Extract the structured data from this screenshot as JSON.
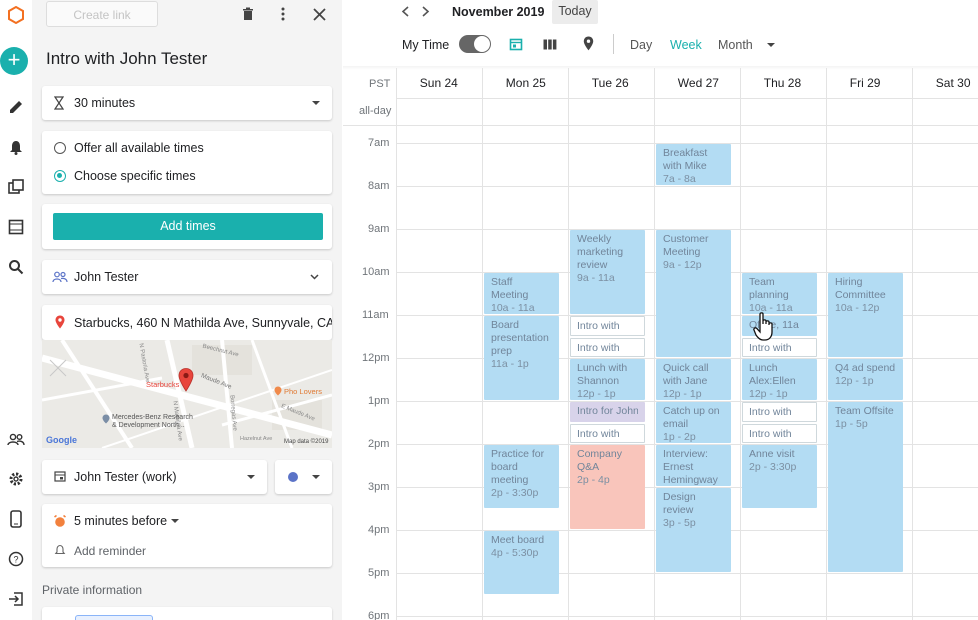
{
  "rail": {
    "add_label": "+"
  },
  "panel": {
    "create_link_label": "Create link",
    "title": "Intro with John Tester",
    "duration": "30 minutes",
    "availability_options": [
      "Offer all available times",
      "Choose specific times"
    ],
    "add_times_label": "Add times",
    "guest": "John Tester",
    "location": "Starbucks, 460 N Mathilda Ave, Sunnyvale, CA 94",
    "map": {
      "place_label": "Starbucks",
      "poi1": "Pho Lovers",
      "poi2": "Mercedes-Benz Research & Development North...",
      "streets": [
        "Beechnut Ave",
        "N Pastoria Ave",
        "Maude Ave",
        "E Maude Ave",
        "N Mathilda Ave",
        "Borregas Ave",
        "Hazelnut Ave"
      ],
      "provider": "Google",
      "attribution": "Map data ©2019"
    },
    "calendar_name": "John Tester (work)",
    "calendar_color": "#5b73c7",
    "reminder": "5 minutes before",
    "add_reminder_label": "Add reminder",
    "private_label": "Private information"
  },
  "calendar": {
    "month": "November 2019",
    "today_label": "Today",
    "my_time_label": "My Time",
    "views": [
      "Day",
      "Week",
      "Month"
    ],
    "active_view": "Week",
    "accent": "#1ab0ad",
    "tz": "PST",
    "allday_label": "all-day",
    "days": [
      "Sun 24",
      "Mon 25",
      "Tue 26",
      "Wed 27",
      "Thu 28",
      "Fri 29",
      "Sat 30"
    ],
    "hours": [
      "7am",
      "8am",
      "9am",
      "10am",
      "11am",
      "12pm",
      "1pm",
      "2pm",
      "3pm",
      "4pm",
      "5pm",
      "6pm"
    ],
    "events": [
      {
        "day": 3,
        "start": 7.0,
        "end": 8.0,
        "title": "Breakfast with Mike",
        "time": "7a - 8a",
        "style": "blue"
      },
      {
        "day": 2,
        "start": 9.0,
        "end": 11.0,
        "title": "Weekly marketing review",
        "time": "9a - 11a",
        "style": "blue"
      },
      {
        "day": 3,
        "start": 9.0,
        "end": 12.0,
        "title": "Customer Meeting",
        "time": "9a - 12p",
        "style": "blue"
      },
      {
        "day": 1,
        "start": 10.0,
        "end": 11.0,
        "title": "Staff Meeting",
        "time": "10a - 11a",
        "style": "blue"
      },
      {
        "day": 4,
        "start": 10.0,
        "end": 11.0,
        "title": "Team planning",
        "time": "10a - 11a",
        "style": "blue"
      },
      {
        "day": 5,
        "start": 10.0,
        "end": 12.0,
        "title": "Hiring Committee",
        "time": "10a - 12p",
        "style": "blue"
      },
      {
        "day": 1,
        "start": 11.0,
        "end": 13.0,
        "title": "Board presentation prep",
        "time": "11a - 1p",
        "style": "blue"
      },
      {
        "day": 2,
        "start": 11.0,
        "end": 11.5,
        "title": "Intro with",
        "time": "",
        "style": "outline"
      },
      {
        "day": 4,
        "start": 11.0,
        "end": 11.5,
        "title": "Office, 11a",
        "time": "",
        "style": "blue"
      },
      {
        "day": 2,
        "start": 11.5,
        "end": 12.0,
        "title": "Intro with",
        "time": "",
        "style": "outline"
      },
      {
        "day": 4,
        "start": 11.5,
        "end": 12.0,
        "title": "Intro with",
        "time": "",
        "style": "outline"
      },
      {
        "day": 2,
        "start": 12.0,
        "end": 13.0,
        "title": "Lunch with Shannon",
        "time": "12p - 1p",
        "style": "blue"
      },
      {
        "day": 3,
        "start": 12.0,
        "end": 13.0,
        "title": "Quick call with Jane",
        "time": "12p - 1p",
        "style": "blue"
      },
      {
        "day": 4,
        "start": 12.0,
        "end": 13.0,
        "title": "Lunch Alex:Ellen",
        "time": "12p - 1p",
        "style": "blue"
      },
      {
        "day": 5,
        "start": 12.0,
        "end": 13.0,
        "title": "Q4 ad spend",
        "time": "12p - 1p",
        "style": "blue"
      },
      {
        "day": 2,
        "start": 13.0,
        "end": 13.5,
        "title": "Intro for John ,",
        "time": "",
        "style": "purple"
      },
      {
        "day": 3,
        "start": 13.0,
        "end": 14.0,
        "title": "Catch up on email",
        "time": "1p - 2p",
        "style": "blue"
      },
      {
        "day": 4,
        "start": 13.0,
        "end": 13.5,
        "title": "Intro with",
        "time": "",
        "style": "outline"
      },
      {
        "day": 5,
        "start": 13.0,
        "end": 17.0,
        "title": "Team Offsite",
        "time": "1p - 5p",
        "style": "blue"
      },
      {
        "day": 2,
        "start": 13.5,
        "end": 14.0,
        "title": "Intro with",
        "time": "",
        "style": "outline"
      },
      {
        "day": 4,
        "start": 13.5,
        "end": 14.0,
        "title": "Intro with",
        "time": "",
        "style": "outline"
      },
      {
        "day": 1,
        "start": 14.0,
        "end": 15.5,
        "title": "Practice for board meeting",
        "time": "2p - 3:30p",
        "style": "blue"
      },
      {
        "day": 2,
        "start": 14.0,
        "end": 16.0,
        "title": "Company Q&A",
        "time": "2p - 4p",
        "style": "pink"
      },
      {
        "day": 3,
        "start": 14.0,
        "end": 15.0,
        "title": "Interview: Ernest Hemingway",
        "time": "",
        "style": "blue"
      },
      {
        "day": 4,
        "start": 14.0,
        "end": 15.5,
        "title": "Anne visit",
        "time": "2p - 3:30p",
        "style": "blue"
      },
      {
        "day": 3,
        "start": 15.0,
        "end": 17.0,
        "title": "Design review",
        "time": "3p - 5p",
        "style": "blue"
      },
      {
        "day": 1,
        "start": 16.0,
        "end": 17.5,
        "title": "Meet board",
        "time": "4p - 5:30p",
        "style": "blue"
      }
    ]
  }
}
